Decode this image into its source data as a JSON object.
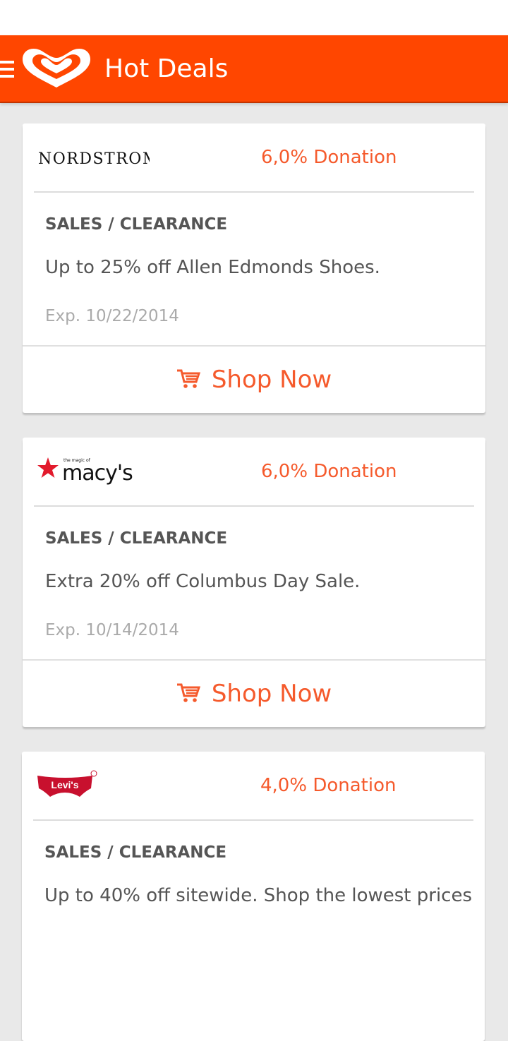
{
  "app_bar": {
    "title": "Hot Deals",
    "menu_icon": "hamburger-menu-icon",
    "logo_icon": "heart-logo-icon",
    "color": "#ff4600"
  },
  "accent_color": "#f55a2c",
  "deals": [
    {
      "store": "NORDSTROM",
      "store_logo": "nordstrom-logo",
      "donation": "6,0% Donation",
      "category": "SALES / CLEARANCE",
      "description": "Up to 25% off Allen Edmonds Shoes.",
      "expiry": "Exp. 10/22/2014",
      "button_label": "Shop Now",
      "button_icon": "shopping-cart-icon"
    },
    {
      "store": "macy's",
      "store_tagline": "the magic of",
      "store_logo": "macys-star-logo",
      "donation": "6,0% Donation",
      "category": "SALES / CLEARANCE",
      "description": "Extra 20% off Columbus Day Sale.",
      "expiry": "Exp. 10/14/2014",
      "button_label": "Shop Now",
      "button_icon": "shopping-cart-icon"
    },
    {
      "store": "Levi's",
      "store_logo": "levis-batwing-logo",
      "donation": "4,0% Donation",
      "category": "SALES / CLEARANCE",
      "description": "Up to 40% off sitewide. Shop the lowest prices"
    }
  ]
}
